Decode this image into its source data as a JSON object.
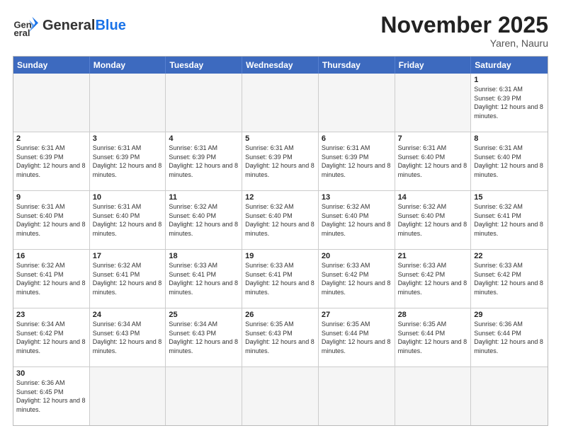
{
  "header": {
    "logo_general": "General",
    "logo_blue": "Blue",
    "month_title": "November 2025",
    "location": "Yaren, Nauru"
  },
  "days_of_week": [
    "Sunday",
    "Monday",
    "Tuesday",
    "Wednesday",
    "Thursday",
    "Friday",
    "Saturday"
  ],
  "weeks": [
    [
      {
        "day": "",
        "empty": true
      },
      {
        "day": "",
        "empty": true
      },
      {
        "day": "",
        "empty": true
      },
      {
        "day": "",
        "empty": true
      },
      {
        "day": "",
        "empty": true
      },
      {
        "day": "",
        "empty": true
      },
      {
        "day": "1",
        "sunrise": "6:31 AM",
        "sunset": "6:39 PM",
        "daylight": "12 hours and 8 minutes."
      }
    ],
    [
      {
        "day": "2",
        "sunrise": "6:31 AM",
        "sunset": "6:39 PM",
        "daylight": "12 hours and 8 minutes."
      },
      {
        "day": "3",
        "sunrise": "6:31 AM",
        "sunset": "6:39 PM",
        "daylight": "12 hours and 8 minutes."
      },
      {
        "day": "4",
        "sunrise": "6:31 AM",
        "sunset": "6:39 PM",
        "daylight": "12 hours and 8 minutes."
      },
      {
        "day": "5",
        "sunrise": "6:31 AM",
        "sunset": "6:39 PM",
        "daylight": "12 hours and 8 minutes."
      },
      {
        "day": "6",
        "sunrise": "6:31 AM",
        "sunset": "6:39 PM",
        "daylight": "12 hours and 8 minutes."
      },
      {
        "day": "7",
        "sunrise": "6:31 AM",
        "sunset": "6:40 PM",
        "daylight": "12 hours and 8 minutes."
      },
      {
        "day": "8",
        "sunrise": "6:31 AM",
        "sunset": "6:40 PM",
        "daylight": "12 hours and 8 minutes."
      }
    ],
    [
      {
        "day": "9",
        "sunrise": "6:31 AM",
        "sunset": "6:40 PM",
        "daylight": "12 hours and 8 minutes."
      },
      {
        "day": "10",
        "sunrise": "6:31 AM",
        "sunset": "6:40 PM",
        "daylight": "12 hours and 8 minutes."
      },
      {
        "day": "11",
        "sunrise": "6:32 AM",
        "sunset": "6:40 PM",
        "daylight": "12 hours and 8 minutes."
      },
      {
        "day": "12",
        "sunrise": "6:32 AM",
        "sunset": "6:40 PM",
        "daylight": "12 hours and 8 minutes."
      },
      {
        "day": "13",
        "sunrise": "6:32 AM",
        "sunset": "6:40 PM",
        "daylight": "12 hours and 8 minutes."
      },
      {
        "day": "14",
        "sunrise": "6:32 AM",
        "sunset": "6:40 PM",
        "daylight": "12 hours and 8 minutes."
      },
      {
        "day": "15",
        "sunrise": "6:32 AM",
        "sunset": "6:41 PM",
        "daylight": "12 hours and 8 minutes."
      }
    ],
    [
      {
        "day": "16",
        "sunrise": "6:32 AM",
        "sunset": "6:41 PM",
        "daylight": "12 hours and 8 minutes."
      },
      {
        "day": "17",
        "sunrise": "6:32 AM",
        "sunset": "6:41 PM",
        "daylight": "12 hours and 8 minutes."
      },
      {
        "day": "18",
        "sunrise": "6:33 AM",
        "sunset": "6:41 PM",
        "daylight": "12 hours and 8 minutes."
      },
      {
        "day": "19",
        "sunrise": "6:33 AM",
        "sunset": "6:41 PM",
        "daylight": "12 hours and 8 minutes."
      },
      {
        "day": "20",
        "sunrise": "6:33 AM",
        "sunset": "6:42 PM",
        "daylight": "12 hours and 8 minutes."
      },
      {
        "day": "21",
        "sunrise": "6:33 AM",
        "sunset": "6:42 PM",
        "daylight": "12 hours and 8 minutes."
      },
      {
        "day": "22",
        "sunrise": "6:33 AM",
        "sunset": "6:42 PM",
        "daylight": "12 hours and 8 minutes."
      }
    ],
    [
      {
        "day": "23",
        "sunrise": "6:34 AM",
        "sunset": "6:42 PM",
        "daylight": "12 hours and 8 minutes."
      },
      {
        "day": "24",
        "sunrise": "6:34 AM",
        "sunset": "6:43 PM",
        "daylight": "12 hours and 8 minutes."
      },
      {
        "day": "25",
        "sunrise": "6:34 AM",
        "sunset": "6:43 PM",
        "daylight": "12 hours and 8 minutes."
      },
      {
        "day": "26",
        "sunrise": "6:35 AM",
        "sunset": "6:43 PM",
        "daylight": "12 hours and 8 minutes."
      },
      {
        "day": "27",
        "sunrise": "6:35 AM",
        "sunset": "6:44 PM",
        "daylight": "12 hours and 8 minutes."
      },
      {
        "day": "28",
        "sunrise": "6:35 AM",
        "sunset": "6:44 PM",
        "daylight": "12 hours and 8 minutes."
      },
      {
        "day": "29",
        "sunrise": "6:36 AM",
        "sunset": "6:44 PM",
        "daylight": "12 hours and 8 minutes."
      }
    ],
    [
      {
        "day": "30",
        "sunrise": "6:36 AM",
        "sunset": "6:45 PM",
        "daylight": "12 hours and 8 minutes."
      },
      {
        "day": "",
        "empty": true
      },
      {
        "day": "",
        "empty": true
      },
      {
        "day": "",
        "empty": true
      },
      {
        "day": "",
        "empty": true
      },
      {
        "day": "",
        "empty": true
      },
      {
        "day": "",
        "empty": true
      }
    ]
  ]
}
